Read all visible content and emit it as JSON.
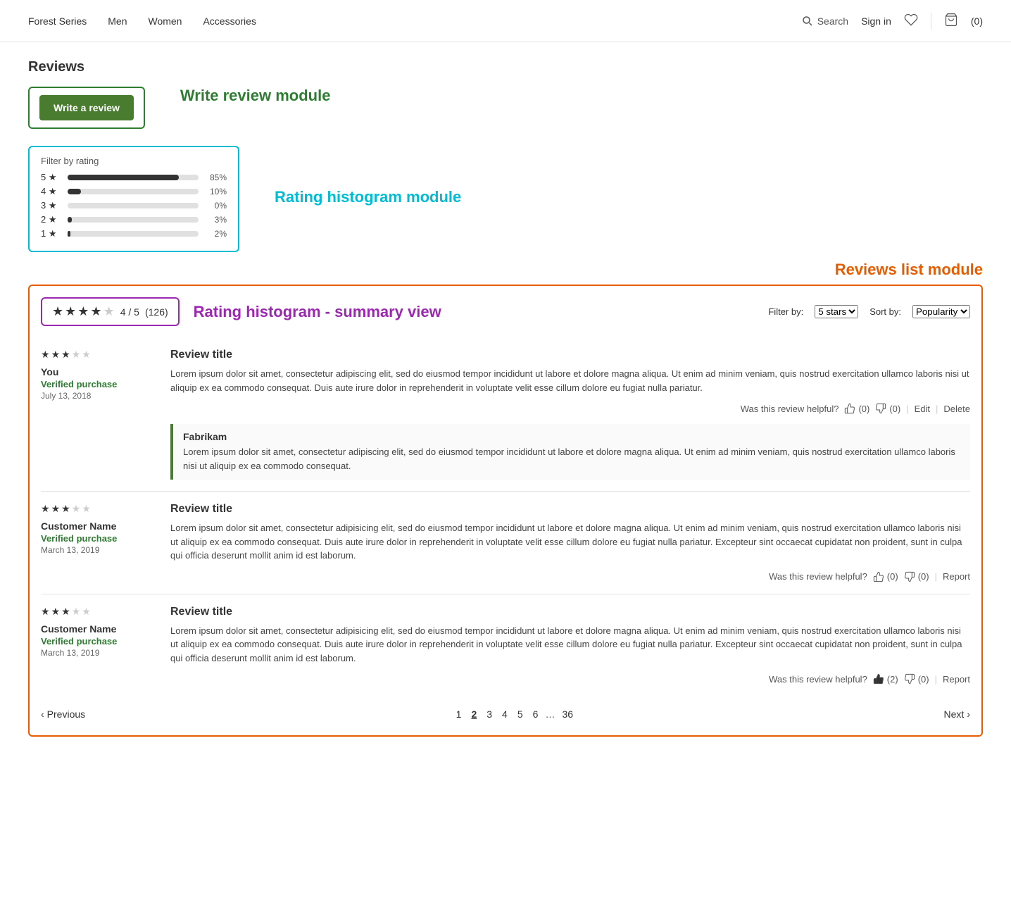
{
  "nav": {
    "links": [
      "Forest Series",
      "Men",
      "Women",
      "Accessories"
    ],
    "search_label": "Search",
    "signin_label": "Sign in",
    "cart_label": "(0)"
  },
  "page": {
    "title": "Reviews",
    "write_review_btn": "Write a review",
    "write_review_module_label": "Write review module",
    "histogram_module_label": "Rating histogram module",
    "reviews_list_module_label": "Reviews list module",
    "histogram_summary_label": "Rating histogram - summary view",
    "filter_by": "Filter by:",
    "sort_by": "Sort by:",
    "filter_value": "5 stars",
    "sort_value": "Popularity",
    "histogram_title": "Filter by rating",
    "histogram_rows": [
      {
        "stars": 5,
        "pct": 85,
        "label": "85%"
      },
      {
        "stars": 4,
        "pct": 10,
        "label": "10%"
      },
      {
        "stars": 3,
        "pct": 0,
        "label": "0%"
      },
      {
        "stars": 2,
        "pct": 3,
        "label": "3%"
      },
      {
        "stars": 1,
        "pct": 2,
        "label": "2%"
      }
    ],
    "summary": {
      "score": "4 / 5",
      "count": "(126)"
    }
  },
  "reviews": [
    {
      "stars": 3,
      "reviewer": "You",
      "verified": "Verified purchase",
      "date": "July 13, 2018",
      "title": "Review title",
      "body": "Lorem ipsum dolor sit amet, consectetur adipiscing elit, sed do eiusmod tempor incididunt ut labore et dolore magna aliqua. Ut enim ad minim veniam, quis nostrud exercitation ullamco laboris nisi ut aliquip ex ea commodo consequat. Duis aute irure dolor in reprehenderit in voluptate velit esse cillum dolore eu fugiat nulla pariatur.",
      "helpful_up": 0,
      "helpful_down": 0,
      "actions": [
        "Edit",
        "Delete"
      ],
      "response": {
        "name": "Fabrikam",
        "body": "Lorem ipsum dolor sit amet, consectetur adipiscing elit, sed do eiusmod tempor incididunt ut labore et dolore magna aliqua. Ut enim ad minim veniam, quis nostrud exercitation ullamco laboris nisi ut aliquip ex ea commodo consequat."
      }
    },
    {
      "stars": 3,
      "reviewer": "Customer Name",
      "verified": "Verified purchase",
      "date": "March 13, 2019",
      "title": "Review title",
      "body": "Lorem ipsum dolor sit amet, consectetur adipisicing elit, sed do eiusmod tempor incididunt ut labore et dolore magna aliqua. Ut enim ad minim veniam, quis nostrud exercitation ullamco laboris nisi ut aliquip ex ea commodo consequat. Duis aute irure dolor in reprehenderit in voluptate velit esse cillum dolore eu fugiat nulla pariatur. Excepteur sint occaecat cupidatat non proident, sunt in culpa qui officia deserunt mollit anim id est laborum.",
      "helpful_up": 0,
      "helpful_down": 0,
      "actions": [
        "Report"
      ],
      "response": null
    },
    {
      "stars": 3,
      "reviewer": "Customer Name",
      "verified": "Verified purchase",
      "date": "March 13, 2019",
      "title": "Review title",
      "body": "Lorem ipsum dolor sit amet, consectetur adipisicing elit, sed do eiusmod tempor incididunt ut labore et dolore magna aliqua. Ut enim ad minim veniam, quis nostrud exercitation ullamco laboris nisi ut aliquip ex ea commodo consequat. Duis aute irure dolor in reprehenderit in voluptate velit esse cillum dolore eu fugiat nulla pariatur. Excepteur sint occaecat cupidatat non proident, sunt in culpa qui officia deserunt mollit anim id est laborum.",
      "helpful_up": 2,
      "helpful_down": 0,
      "actions": [
        "Report"
      ],
      "response": null
    }
  ],
  "pagination": {
    "prev_label": "Previous",
    "next_label": "Next",
    "pages": [
      "1",
      "2",
      "3",
      "4",
      "5",
      "6",
      "…",
      "36"
    ],
    "active_page": "2"
  },
  "helpful_label": "Was this review helpful?"
}
